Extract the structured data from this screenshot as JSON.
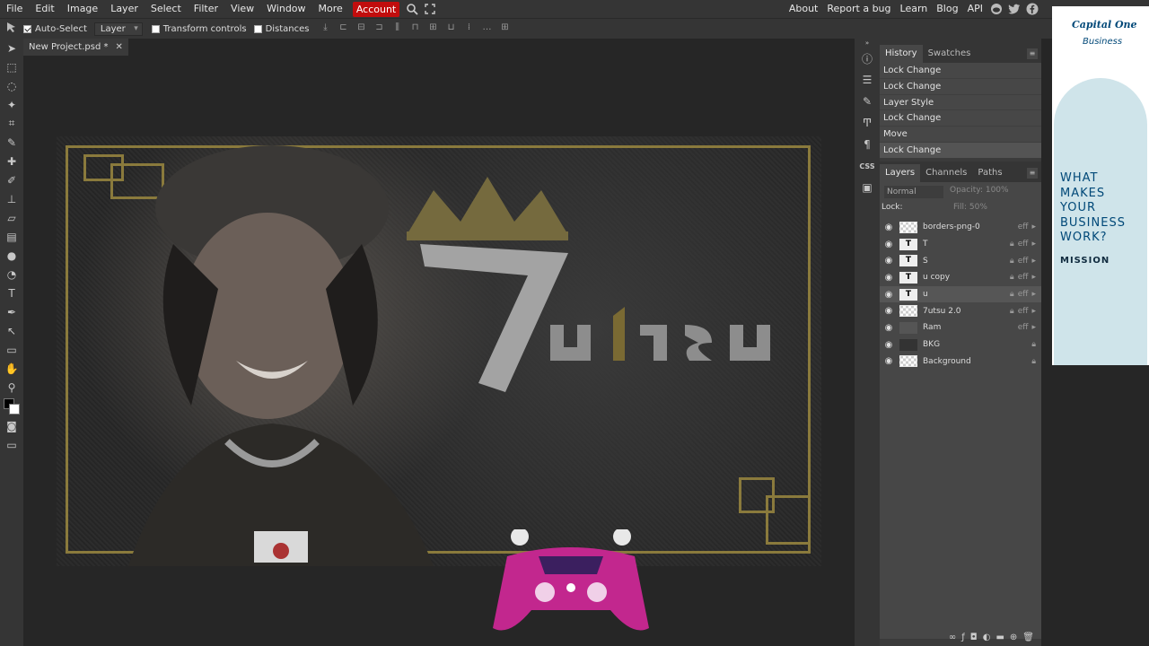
{
  "menu": {
    "items": [
      "File",
      "Edit",
      "Image",
      "Layer",
      "Select",
      "Filter",
      "View",
      "Window",
      "More"
    ],
    "account": "Account",
    "right_links": [
      "About",
      "Report a bug",
      "Learn",
      "Blog",
      "API"
    ],
    "icons": [
      "search-icon",
      "fullscreen-icon",
      "reddit-icon",
      "twitter-icon",
      "facebook-icon"
    ]
  },
  "options": {
    "auto_select": "Auto-Select",
    "auto_select_checked": true,
    "target": "Layer",
    "transform_controls": "Transform controls",
    "distances": "Distances"
  },
  "document": {
    "tab_title": "New Project.psd *"
  },
  "history": {
    "tabs": [
      "History",
      "Swatches"
    ],
    "items": [
      "Lock Change",
      "Lock Change",
      "Layer Style",
      "Lock Change",
      "Move",
      "Lock Change"
    ]
  },
  "layers_panel": {
    "tabs": [
      "Layers",
      "Channels",
      "Paths"
    ],
    "blend_mode": "Normal",
    "opacity_label": "Opacity: 100%",
    "lock_label": "Lock:",
    "fill_label": "Fill: 50%",
    "layers": [
      {
        "name": "borders-png-0",
        "thumb": "",
        "locked": false,
        "fx": "eff"
      },
      {
        "name": "T",
        "thumb": "T",
        "locked": true,
        "fx": "eff"
      },
      {
        "name": "S",
        "thumb": "T",
        "locked": true,
        "fx": "eff"
      },
      {
        "name": "u copy",
        "thumb": "T",
        "locked": true,
        "fx": "eff"
      },
      {
        "name": "u",
        "thumb": "T",
        "locked": true,
        "fx": "eff"
      },
      {
        "name": "7utsu 2.0",
        "thumb": "",
        "locked": true,
        "fx": "eff"
      },
      {
        "name": "Ram",
        "thumb": "",
        "locked": false,
        "fx": "eff"
      },
      {
        "name": "BKG",
        "thumb": "",
        "locked": true,
        "fx": ""
      },
      {
        "name": "Background",
        "thumb": "",
        "locked": true,
        "fx": ""
      }
    ]
  },
  "ad": {
    "brand": "Capital One",
    "brand_sub": "Business",
    "headline_lines": [
      "WHAT",
      "MAKES",
      "YOUR",
      "BUSINESS",
      "WORK?"
    ],
    "cta": "MISSION"
  },
  "colors": {
    "accent_account": "#c10d0d",
    "panel_bg": "#474747",
    "frame_gold": "#8a7a3c"
  }
}
